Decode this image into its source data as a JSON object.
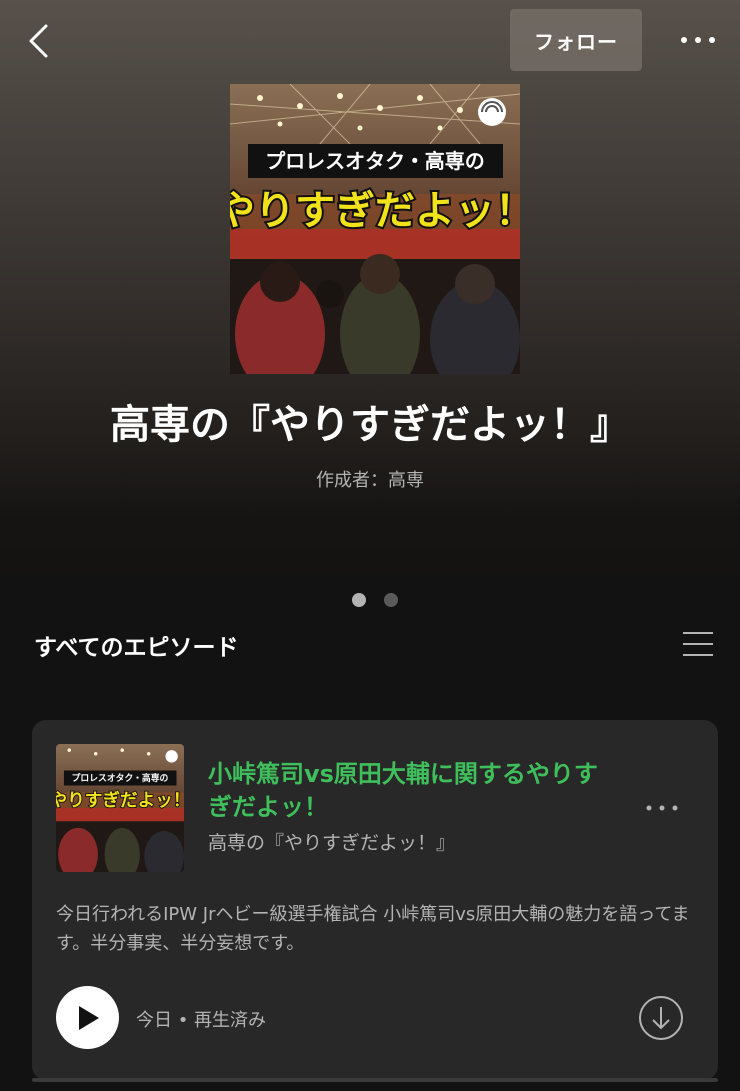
{
  "header": {
    "follow_label": "フォロー"
  },
  "podcast": {
    "title": "高専の『やりすぎだよッ！』",
    "creator": "作成者：高専",
    "cover_line1": "プロレスオタク・高専の",
    "cover_line2": "やりすぎだよッ！"
  },
  "carousel": {
    "pages": 2,
    "active": 0
  },
  "episodes_section": {
    "title": "すべてのエピソード"
  },
  "episode": {
    "title": "小峠篤司vs原田大輔に関するやりすぎだよッ！",
    "show": "高専の『やりすぎだよッ！』",
    "description": "今日行われるIPW Jrヘビー級選手権試合 小峠篤司vs原田大輔の魅力を語ってます。半分事実、半分妄想です。",
    "meta": "今日 • 再生済み",
    "thumb_line1": "プロレスオタク・高専の",
    "thumb_line2": "やりすぎだよッ！"
  },
  "colors": {
    "accent_green": "#3fbf5c",
    "card_bg": "#282828",
    "secondary_text": "#b3b3b3"
  },
  "icons": [
    "back-icon",
    "more-icon",
    "list-icon",
    "play-icon",
    "download-icon",
    "podcast-icon"
  ]
}
